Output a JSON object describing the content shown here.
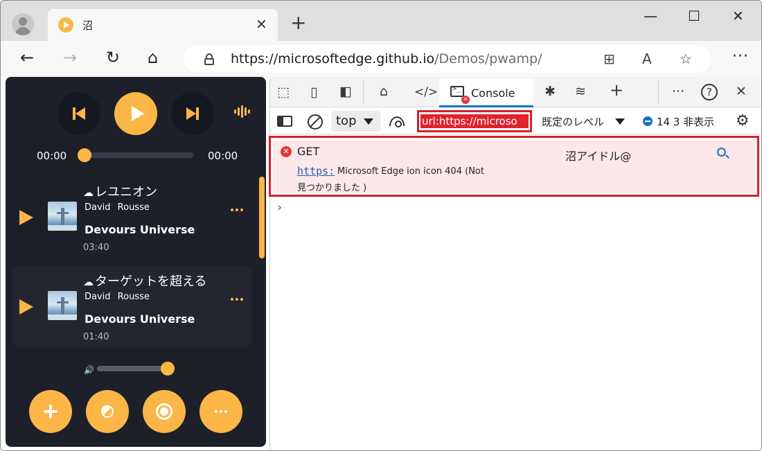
{
  "browser": {
    "tab_title": "沼",
    "tab_close": "✕",
    "new_tab": "+",
    "window_controls": {
      "minimize": "—",
      "maximize": "☐",
      "close": "✕"
    },
    "nav": {
      "back": "←",
      "forward": "→",
      "refresh": "↻",
      "home": "⌂"
    },
    "url_host": "https://microsoftedge.github.io",
    "url_path": "/Demos/pwamp/",
    "omnibox_icons": {
      "apps": "⊞",
      "read_aloud": "A",
      "favorite": "☆"
    },
    "more_label": "···"
  },
  "player": {
    "current_time": "00:00",
    "total_time": "00:00",
    "songs": [
      {
        "title": "レユニオン",
        "artist": "David Rousse",
        "album": "Devours Universe",
        "duration": "03:40"
      },
      {
        "title": "ターゲットを超える",
        "artist": "David Rousse",
        "album": "Devours Universe",
        "duration": "01:40"
      }
    ],
    "volume_icon": "🔊"
  },
  "devtools": {
    "tab_icons": {
      "inspect": "⬚",
      "device": "▯",
      "dock": "◧",
      "welcome": "⌂",
      "elements": "</>",
      "sources": "✱",
      "network": "≋",
      "add": "+",
      "more": "···",
      "help": "?",
      "close": "✕"
    },
    "console_label": "Console",
    "context": "top",
    "filter_text": "url:https://microso",
    "levels_label": "既定のレベル",
    "counts": "14 3 非表示",
    "gear": "⚙",
    "error": {
      "method": "GET",
      "source": "沼アイドル@",
      "link": "https:",
      "message_line1": "Microsoft Edge ion icon 404 (Not",
      "message_line2": "見つかりました )"
    },
    "prompt": "›"
  }
}
